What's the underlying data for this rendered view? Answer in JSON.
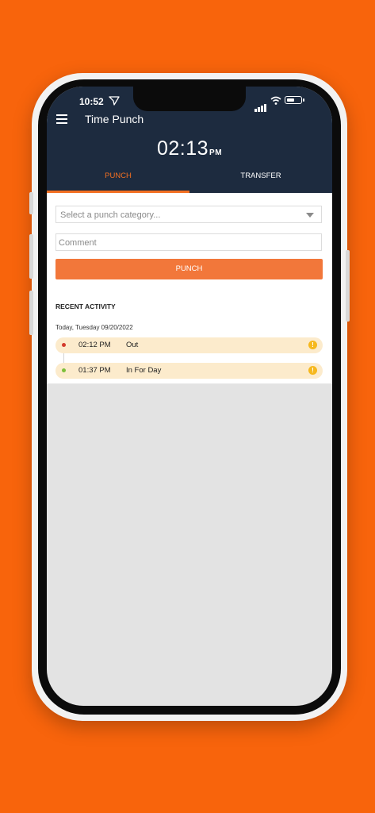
{
  "status_bar": {
    "time": "10:52",
    "battery_level": 0.6
  },
  "header": {
    "title": "Time Punch",
    "clock": "02:13",
    "clock_ampm": "PM"
  },
  "tabs": [
    {
      "label": "PUNCH",
      "active": true
    },
    {
      "label": "TRANSFER",
      "active": false
    }
  ],
  "form": {
    "category_placeholder": "Select a punch category...",
    "comment_placeholder": "Comment",
    "punch_button": "PUNCH"
  },
  "recent": {
    "title": "RECENT ACTIVITY",
    "date": "Today, Tuesday  09/20/2022",
    "items": [
      {
        "time": "02:12 PM",
        "label": "Out",
        "dot_color": "#d33a2c"
      },
      {
        "time": "01:37 PM",
        "label": "In For Day",
        "dot_color": "#7cbf3a"
      }
    ]
  },
  "colors": {
    "background": "#f8640c",
    "header": "#1d2b3f",
    "accent": "#f26f21",
    "activity_row": "#fcebcc",
    "warning": "#f6b81d"
  }
}
